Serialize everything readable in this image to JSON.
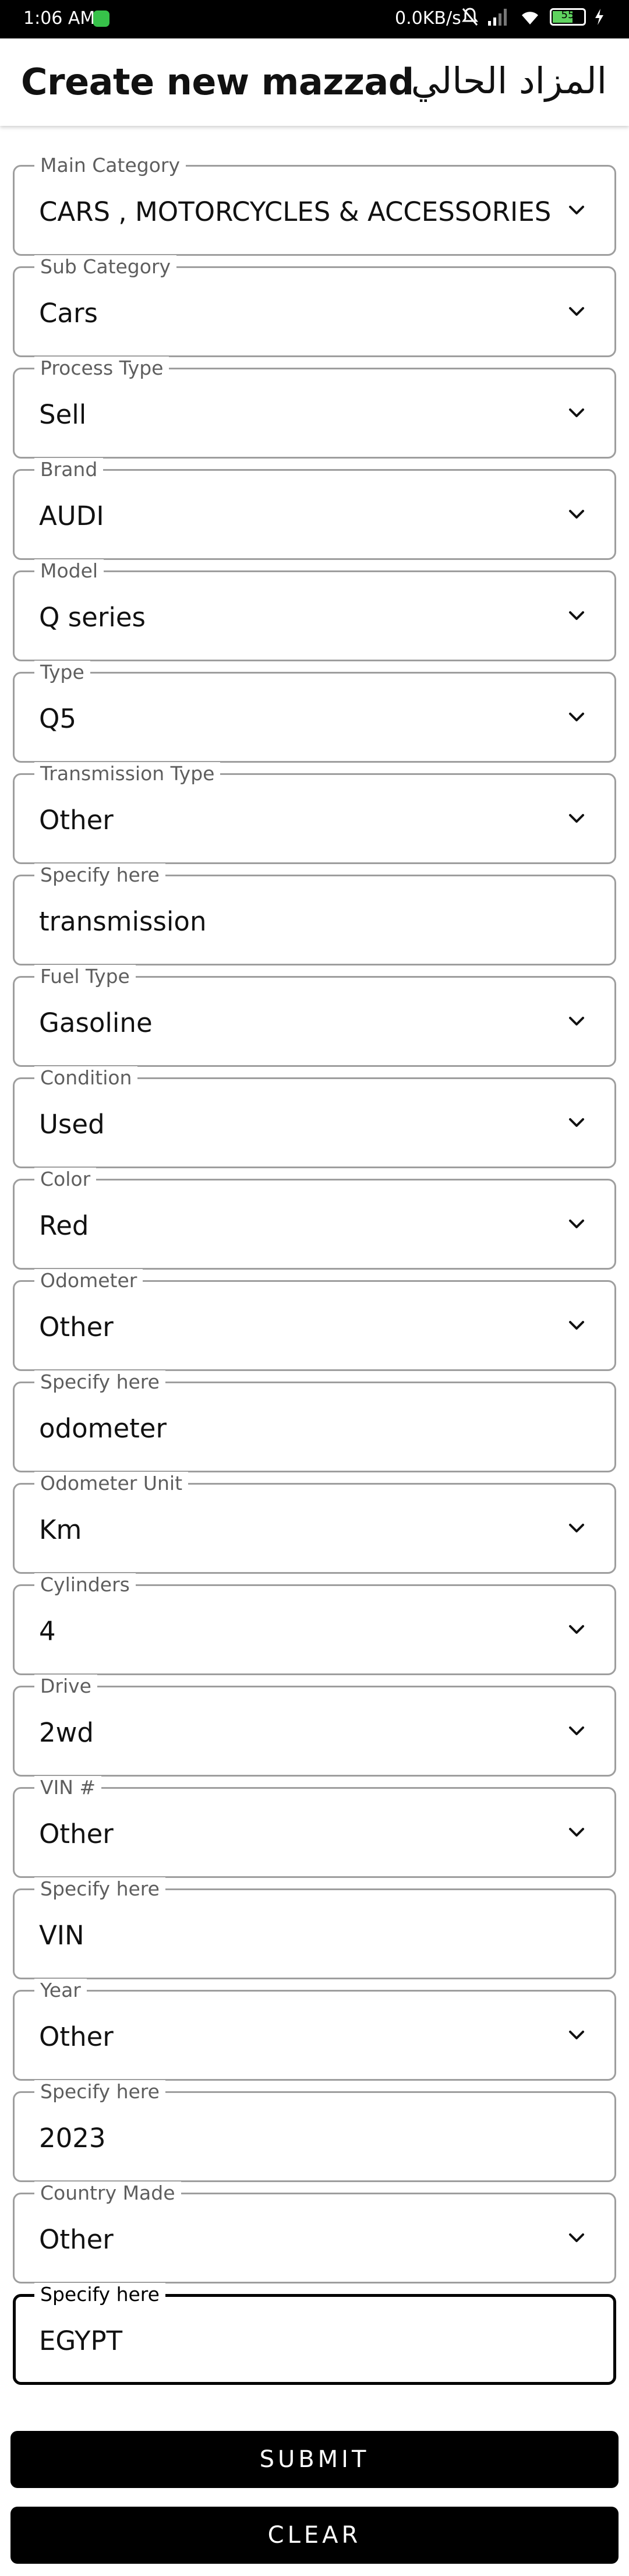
{
  "status_bar": {
    "time": "1:06 AM",
    "net_speed": "0.0KB/s",
    "battery": "55"
  },
  "app_bar": {
    "title": "Create new mazzad",
    "arabic_title": "المزاد الحالي"
  },
  "fields": [
    {
      "label": "Main Category",
      "value": "CARS , MOTORCYCLES & ACCESSORIES",
      "type": "dropdown"
    },
    {
      "label": "Sub Category",
      "value": "Cars",
      "type": "dropdown"
    },
    {
      "label": "Process  Type",
      "value": "Sell",
      "type": "dropdown"
    },
    {
      "label": "Brand",
      "value": "AUDI",
      "type": "dropdown"
    },
    {
      "label": "Model",
      "value": "Q series",
      "type": "dropdown"
    },
    {
      "label": "Type",
      "value": "Q5",
      "type": "dropdown"
    },
    {
      "label": "Transmission Type",
      "value": "Other",
      "type": "dropdown"
    },
    {
      "label": "Specify here",
      "value": "transmission",
      "type": "text"
    },
    {
      "label": "Fuel Type",
      "value": "Gasoline",
      "type": "dropdown"
    },
    {
      "label": "Condition",
      "value": "Used",
      "type": "dropdown"
    },
    {
      "label": "Color",
      "value": "Red",
      "type": "dropdown"
    },
    {
      "label": "Odometer",
      "value": "Other",
      "type": "dropdown"
    },
    {
      "label": "Specify here",
      "value": "odometer",
      "type": "text"
    },
    {
      "label": "Odometer Unit",
      "value": "Km",
      "type": "dropdown"
    },
    {
      "label": "Cylinders",
      "value": "4",
      "type": "dropdown"
    },
    {
      "label": "Drive",
      "value": "2wd",
      "type": "dropdown"
    },
    {
      "label": "VIN #",
      "value": "Other",
      "type": "dropdown"
    },
    {
      "label": "Specify here",
      "value": "VIN",
      "type": "text"
    },
    {
      "label": "Year",
      "value": "Other",
      "type": "dropdown"
    },
    {
      "label": "Specify here",
      "value": "2023",
      "type": "text"
    },
    {
      "label": "Country Made",
      "value": "Other",
      "type": "dropdown"
    },
    {
      "label": "Specify here",
      "value": "EGYPT",
      "type": "text",
      "focused": true
    }
  ],
  "buttons": {
    "submit": "SUBMIT",
    "clear": "CLEAR"
  },
  "colors": {
    "button_bg": "#000000",
    "border": "#9e9e9e",
    "label": "#5e5e5e"
  }
}
